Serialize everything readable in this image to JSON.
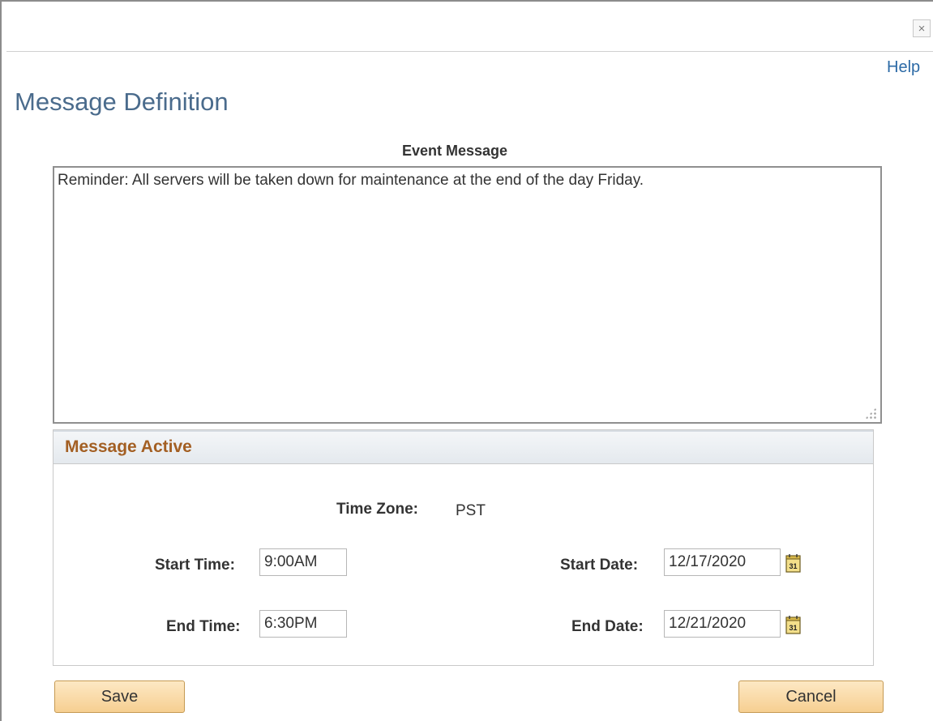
{
  "window": {
    "close_glyph": "×",
    "help_label": "Help"
  },
  "page": {
    "title": "Message Definition"
  },
  "event_message": {
    "label": "Event Message",
    "value": "Reminder: All servers will be taken down for maintenance at the end of the day Friday."
  },
  "message_active": {
    "title": "Message Active",
    "time_zone_label": "Time Zone:",
    "time_zone_value": "PST",
    "start_time_label": "Start Time:",
    "start_time_value": "9:00AM",
    "start_date_label": "Start Date:",
    "start_date_value": "12/17/2020",
    "end_time_label": "End Time:",
    "end_time_value": "6:30PM",
    "end_date_label": "End Date:",
    "end_date_value": "12/21/2020",
    "calendar_icon_text": "31"
  },
  "buttons": {
    "save_label": "Save",
    "cancel_label": "Cancel"
  },
  "colors": {
    "title_blue": "#4a6b8c",
    "link_blue": "#2c6aa6",
    "section_orange": "#a35f23",
    "button_fill": "#f6cf91"
  }
}
